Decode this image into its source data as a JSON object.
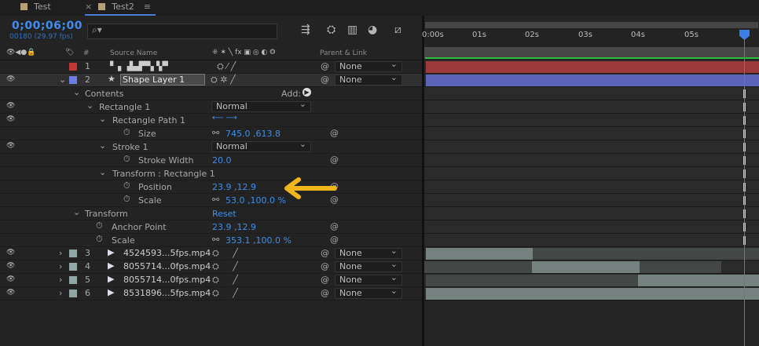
{
  "tabs": [
    {
      "label": "Test"
    },
    {
      "label": "Test2"
    }
  ],
  "header": {
    "timecode": "0;00;06;00",
    "fps": "00180 (29.97 fps)",
    "search_placeholder": "⌕▾"
  },
  "columns": {
    "num": "#",
    "source": "Source Name",
    "switches": "⁜ ✶ ╲ fx ▣ ◎ ◐ ⭗",
    "parent": "Parent & Link"
  },
  "layers": [
    {
      "num": "1",
      "name": "",
      "parent": "None",
      "label_color": "#c03535",
      "mode": ""
    },
    {
      "num": "2",
      "name": "Shape Layer 1",
      "parent": "None",
      "label_color": "#6d7de0"
    }
  ],
  "props": {
    "contents": "Contents",
    "add": "Add:",
    "rect1": "Rectangle 1",
    "rect1_mode": "Normal",
    "rectpath": "Rectangle Path 1",
    "size": "Size",
    "size_val": "745.0 ,613.8",
    "stroke": "Stroke 1",
    "stroke_mode": "Normal",
    "strokewidth": "Stroke Width",
    "strokewidth_val": "20.0",
    "transform_rect": "Transform : Rectangle 1",
    "position": "Position",
    "position_val": "23.9 ,12.9",
    "scale": "Scale",
    "scale_val": "53.0 ,100.0 %",
    "transform": "Transform",
    "reset": "Reset",
    "anchor": "Anchor Point",
    "anchor_val": "23.9 ,12.9",
    "scale2": "Scale",
    "scale2_val": "353.1 ,100.0 %"
  },
  "footage": [
    {
      "num": "3",
      "name": "4524593...5fps.mp4",
      "parent": "None"
    },
    {
      "num": "4",
      "name": "8055714...0fps.mp4",
      "parent": "None"
    },
    {
      "num": "5",
      "name": "8055714...0fps.mp4",
      "parent": "None"
    },
    {
      "num": "6",
      "name": "8531896...5fps.mp4",
      "parent": "None"
    }
  ],
  "ruler": [
    "0:00s",
    "01s",
    "02s",
    "03s",
    "04s",
    "05s"
  ],
  "colors": {
    "accent": "#3b8de8",
    "arrow": "#f2b51c",
    "layer1": "#c03535",
    "shape": "#6d7de0",
    "footage": "#8fa8a4"
  }
}
